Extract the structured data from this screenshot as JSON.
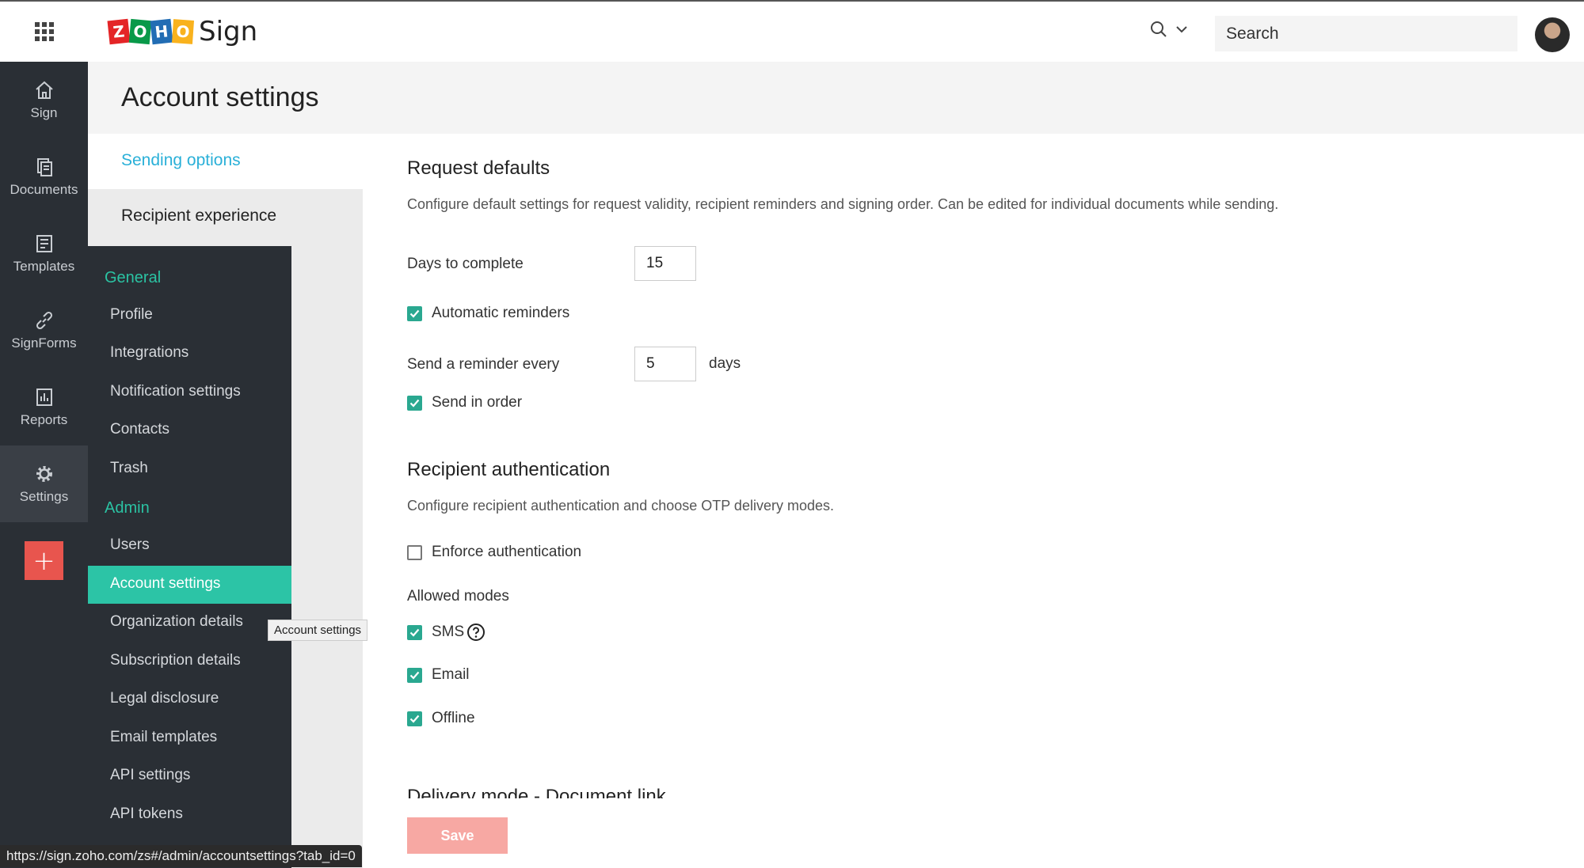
{
  "brand": {
    "letters": [
      "Z",
      "O",
      "H",
      "O"
    ],
    "letter_colors": [
      "#e42527",
      "#089949",
      "#226db4",
      "#f9b21d"
    ],
    "product": "Sign"
  },
  "topbar": {
    "apps_icon": "grid-icon",
    "search_placeholder": "Search"
  },
  "leftnav": {
    "items": [
      {
        "label": "Sign",
        "icon": "home-icon"
      },
      {
        "label": "Documents",
        "icon": "documents-icon"
      },
      {
        "label": "Templates",
        "icon": "templates-icon"
      },
      {
        "label": "SignForms",
        "icon": "link-icon"
      },
      {
        "label": "Reports",
        "icon": "reports-icon"
      },
      {
        "label": "Settings",
        "icon": "gear-icon"
      }
    ],
    "add_label": "+"
  },
  "page": {
    "title": "Account settings"
  },
  "subnav": {
    "tabs": [
      "Sending options",
      "Recipient experience"
    ]
  },
  "menu": {
    "general_heading": "General",
    "general_items": [
      "Profile",
      "Integrations",
      "Notification settings",
      "Contacts",
      "Trash"
    ],
    "admin_heading": "Admin",
    "admin_items": [
      "Users",
      "Account settings",
      "Organization details",
      "Subscription details",
      "Legal disclosure",
      "Email templates",
      "API settings",
      "API tokens"
    ]
  },
  "tooltip": "Account settings",
  "status_url": "https://sign.zoho.com/zs#/admin/accountsettings?tab_id=0",
  "request_defaults": {
    "title": "Request defaults",
    "description": "Configure default settings for request validity, recipient reminders and signing order. Can be edited for individual documents while sending.",
    "days_label": "Days to complete",
    "days_value": "15",
    "auto_reminders": "Automatic reminders",
    "reminder_label": "Send a reminder every",
    "reminder_value": "5",
    "reminder_unit": "days",
    "send_in_order": "Send in order"
  },
  "recipient_auth": {
    "title": "Recipient authentication",
    "description": "Configure recipient authentication and choose OTP delivery modes.",
    "enforce": "Enforce authentication",
    "allowed_modes_label": "Allowed modes",
    "modes": [
      "SMS",
      "Email",
      "Offline"
    ]
  },
  "delivery": {
    "title": "Delivery mode - Document link"
  },
  "save_label": "Save",
  "colors": {
    "accent_teal": "#2cc4a6",
    "link_blue": "#2ab0d8",
    "save_pink": "#f7a8a3",
    "add_red": "#e8554e",
    "nav_dark": "#2a2f35"
  }
}
